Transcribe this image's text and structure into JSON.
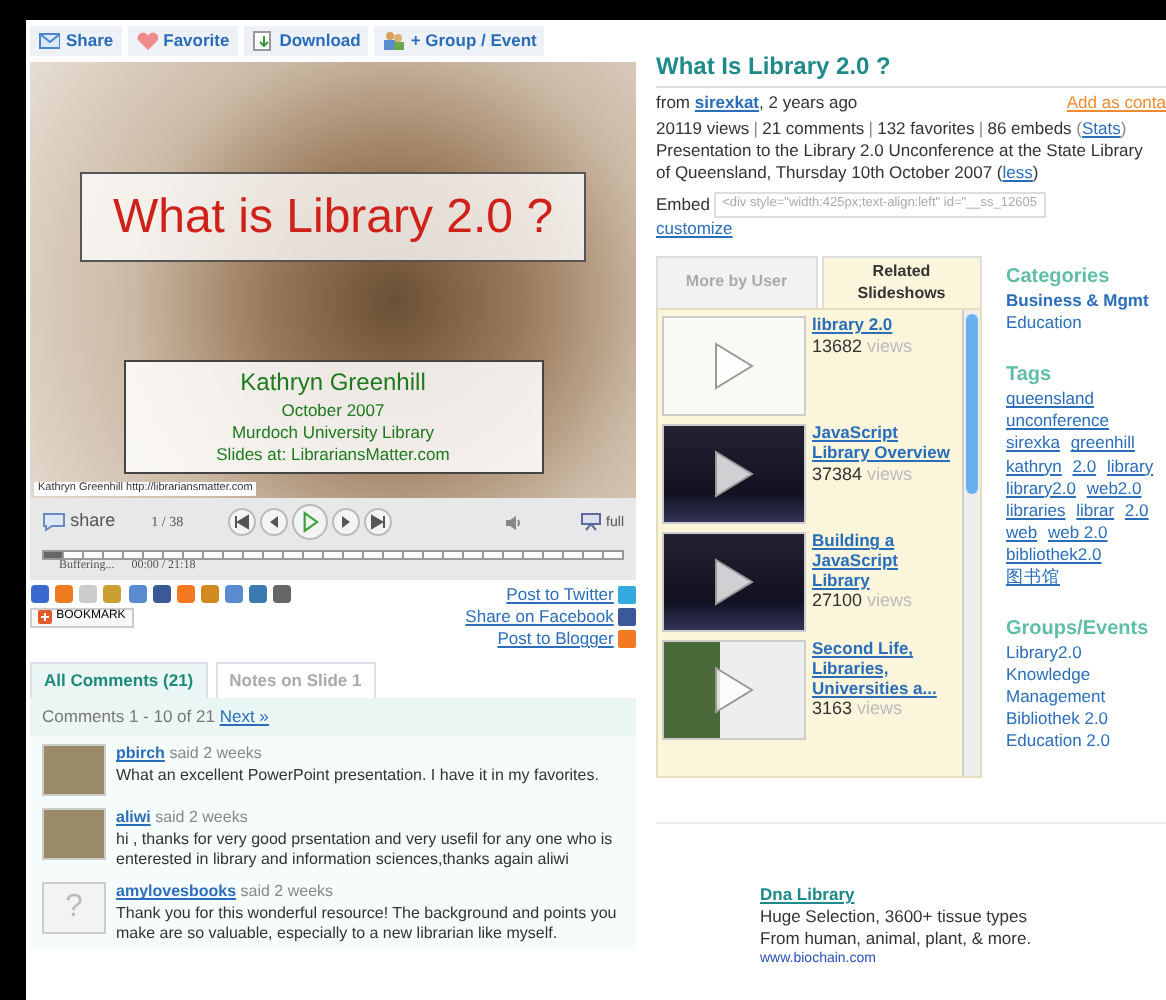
{
  "toolbar": [
    {
      "label": "Share",
      "kind": "share"
    },
    {
      "label": "Favorite",
      "kind": "favorite"
    },
    {
      "label": "Download",
      "kind": "download"
    },
    {
      "label": "+ Group / Event",
      "kind": "group"
    }
  ],
  "player": {
    "slide_title": "What is Library 2.0 ?",
    "slide_lines": [
      "Kathryn Greenhill",
      "October 2007",
      "Murdoch University Library",
      "Slides at: LibrariansMatter.com"
    ],
    "photo_caption": "Kathryn Greenhill http://librariansmatter.com",
    "share": "share",
    "page": "1 / 38",
    "full": "full",
    "status": "Buffering...",
    "time": "00:00 / 21:18"
  },
  "bookmark": "BOOKMARK",
  "social_links": [
    {
      "label": "Post to Twitter",
      "color": "#33aadd"
    },
    {
      "label": "Share on Facebook",
      "color": "#3b5998"
    },
    {
      "label": "Post to Blogger",
      "color": "#f37a21"
    }
  ],
  "comment_tabs": [
    {
      "label": "All Comments (21)",
      "selected": true
    },
    {
      "label": "Notes on Slide 1",
      "selected": false
    }
  ],
  "comments_summary": "Comments 1 - 10 of 21",
  "comments_next": "Next »",
  "comments": [
    {
      "user": "pbirch",
      "when": "said 2 weeks",
      "text": "What an excellent PowerPoint presentation. I have it in my favorites.",
      "avatar": {
        "kind": "photo"
      }
    },
    {
      "user": "aliwi",
      "when": "said 2 weeks",
      "text": "hi , thanks for very good prsentation and very usefil for any one who is enterested in library and information sciences,thanks again aliwi",
      "avatar": {
        "kind": "photo"
      }
    },
    {
      "user": "amylovesbooks",
      "when": "said 2 weeks",
      "text": "Thank you for this wonderful resource! The background and points you make are so valuable, especially to a new librarian like myself.",
      "avatar": {
        "kind": "placeholder",
        "glyph": "?"
      }
    }
  ],
  "title": "What Is Library 2.0 ?",
  "from": "from",
  "author": "sirexkat",
  "age": ", 2 years ago",
  "add_contact": "Add as conta",
  "stats": [
    "20119 views",
    "21 comments",
    "132 favorites",
    "86 embeds"
  ],
  "stats_separator": "|",
  "stats_link": {
    "open": "(",
    "label": "Stats",
    "close": ")"
  },
  "description": "Presentation to the Library 2.0 Unconference at the State Library of Queensland, Thursday 10th October 2007",
  "less": {
    "open": "(",
    "label": "less",
    "close": ")"
  },
  "embed_label": "Embed",
  "embed_value": "<div style=\"width:425px;text-align:left\" id=\"__ss_12605",
  "customize": "customize",
  "related_tabs": [
    {
      "label": "More by User",
      "selected": false
    },
    {
      "label": "Related Slideshows",
      "selected": true
    }
  ],
  "related": [
    {
      "title": "library 2.0",
      "views": "13682",
      "views_label": "views",
      "kind": "light"
    },
    {
      "title": "JavaScript Library Overview",
      "views": "37384",
      "views_label": "views",
      "kind": "dark"
    },
    {
      "title": "Building a JavaScript Library",
      "views": "27100",
      "views_label": "views",
      "kind": "dark"
    },
    {
      "title": "Second Life, Libraries, Universities a...",
      "views": "3163",
      "views_label": "views",
      "kind": "photo"
    }
  ],
  "categories": {
    "heading": "Categories",
    "items": [
      {
        "label": "Business & Mgmt",
        "bold": true
      },
      {
        "label": "Education",
        "bold": false
      }
    ]
  },
  "tags": {
    "heading": "Tags",
    "items": [
      "queensland",
      "unconference",
      "sirexka",
      "greenhill",
      "kathryn",
      "2.0",
      "library",
      "library2.0",
      "web2.0",
      "libraries",
      "librar",
      "2.0",
      "web",
      "web 2.0",
      "bibliothek2.0",
      "图书馆"
    ]
  },
  "groups": {
    "heading": "Groups/Events",
    "items": [
      "Library2.0",
      "Knowledge Management",
      "Bibliothek 2.0",
      "Education 2.0"
    ]
  },
  "ad": {
    "title": "Dna Library",
    "text": "Huge Selection, 3600+ tissue types From human, animal, plant, & more.",
    "url": "www.biochain.com"
  }
}
